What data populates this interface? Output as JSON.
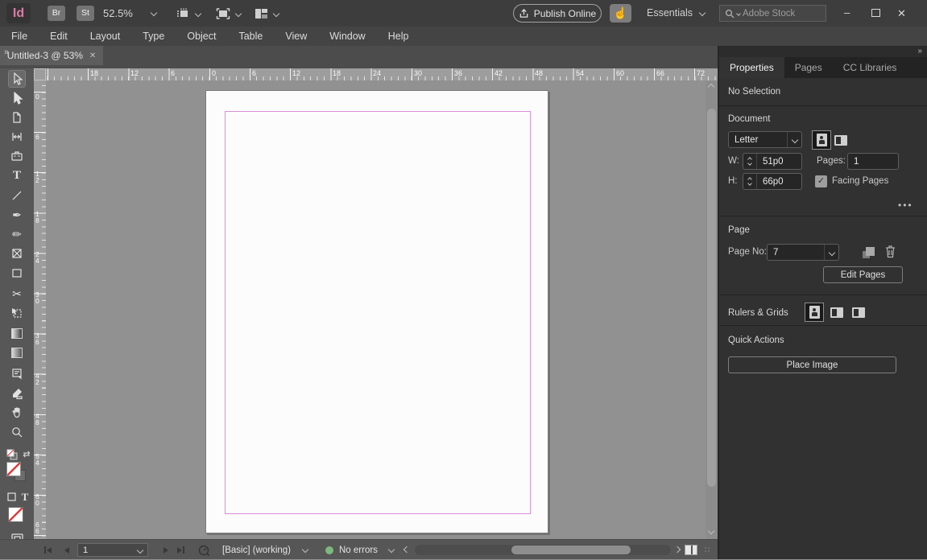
{
  "titlebar": {
    "logo": "Id",
    "bridge_label": "Br",
    "stock_label": "St",
    "zoom_level": "52.5%",
    "publish_label": "Publish Online",
    "touch_glyph": "☝",
    "workspace": "Essentials",
    "stock_placeholder": "Adobe Stock",
    "minimize_glyph": "–",
    "close_glyph": "✕"
  },
  "menubar": {
    "items": [
      "File",
      "Edit",
      "Layout",
      "Type",
      "Object",
      "Table",
      "View",
      "Window",
      "Help"
    ]
  },
  "tabbar": {
    "expand_glyph": "»",
    "title": "Untitled-3 @ 53%",
    "close_glyph": "✕"
  },
  "toolbar": {
    "glyphs": {
      "type": "T",
      "pen": "✒",
      "pencil": "✏",
      "scissors": "✂",
      "swap": "⇄",
      "text_mode": "T"
    }
  },
  "rulers": {
    "h": [
      "18",
      "12",
      "6",
      "0",
      "6",
      "12",
      "18",
      "24",
      "30",
      "36",
      "42",
      "48",
      "54",
      "60",
      "66",
      "72"
    ],
    "v": [
      "0",
      "6",
      "1\n2",
      "1\n8",
      "2\n4",
      "3\n0",
      "3\n6",
      "4\n2",
      "4\n8",
      "5\n4",
      "6\n0",
      "6\n6"
    ]
  },
  "panel": {
    "collapse_glyph": "»",
    "tabs": [
      "Properties",
      "Pages",
      "CC Libraries"
    ],
    "selection_status": "No Selection",
    "document": {
      "heading": "Document",
      "preset": "Letter",
      "w_label": "W:",
      "w_value": "51p0",
      "h_label": "H:",
      "h_value": "66p0",
      "pages_label": "Pages:",
      "pages_value": "1",
      "facing_label": "Facing Pages",
      "check_glyph": "✓",
      "more_glyph": "•••"
    },
    "page": {
      "heading": "Page",
      "no_label": "Page No:",
      "no_value": "7",
      "edit_button": "Edit Pages"
    },
    "rulers_grids": {
      "heading": "Rulers & Grids"
    },
    "quick_actions": {
      "heading": "Quick Actions",
      "place_image_button": "Place Image"
    }
  },
  "statusbar": {
    "page_value": "1",
    "preflight_profile": "[Basic] (working)",
    "errors_label": "No errors"
  },
  "colors": {
    "margin_guide": "#d98fd9",
    "status_ok_green": "#7db87d",
    "logo_pink": "#d87ca8",
    "panel_bg": "#313131",
    "pasteboard": "#919191"
  }
}
